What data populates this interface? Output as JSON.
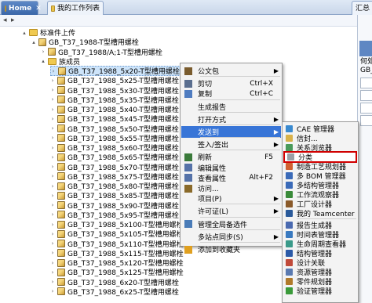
{
  "tabs": {
    "home": "Home",
    "worklist": "我的工作列表",
    "summary": "汇总"
  },
  "right_panel": {
    "line1": "何处引",
    "line2": "GB_T"
  },
  "tree": [
    {
      "text": "标准件上传",
      "indent": 1,
      "icon": "folder",
      "twist": "▴"
    },
    {
      "text": "GB_T37_1988-T型槽用螺栓",
      "indent": 2,
      "icon": "item",
      "twist": "▴"
    },
    {
      "text": "GB_T37_1988/A;1-T型槽用螺栓",
      "indent": 3,
      "icon": "item",
      "twist": "›"
    },
    {
      "text": "族成员",
      "indent": 3,
      "icon": "folder",
      "twist": "▴"
    },
    {
      "text": "GB_T37_1988_5x20-T型槽用螺栓",
      "indent": 4,
      "icon": "item",
      "twist": "›",
      "selected": true
    },
    {
      "text": "GB_T37_1988_5x25-T型槽用螺栓",
      "indent": 4,
      "icon": "item",
      "twist": "›"
    },
    {
      "text": "GB_T37_1988_5x30-T型槽用螺栓",
      "indent": 4,
      "icon": "item",
      "twist": "›"
    },
    {
      "text": "GB_T37_1988_5x35-T型槽用螺栓",
      "indent": 4,
      "icon": "item",
      "twist": "›"
    },
    {
      "text": "GB_T37_1988_5x40-T型槽用螺栓",
      "indent": 4,
      "icon": "item",
      "twist": "›"
    },
    {
      "text": "GB_T37_1988_5x45-T型槽用螺栓",
      "indent": 4,
      "icon": "item",
      "twist": "›"
    },
    {
      "text": "GB_T37_1988_5x50-T型槽用螺栓",
      "indent": 4,
      "icon": "item",
      "twist": "›"
    },
    {
      "text": "GB_T37_1988_5x55-T型槽用螺栓",
      "indent": 4,
      "icon": "item",
      "twist": "›"
    },
    {
      "text": "GB_T37_1988_5x60-T型槽用螺栓",
      "indent": 4,
      "icon": "item",
      "twist": "›"
    },
    {
      "text": "GB_T37_1988_5x65-T型槽用螺栓",
      "indent": 4,
      "icon": "item",
      "twist": "›"
    },
    {
      "text": "GB_T37_1988_5x70-T型槽用螺栓",
      "indent": 4,
      "icon": "item",
      "twist": "›"
    },
    {
      "text": "GB_T37_1988_5x75-T型槽用螺栓",
      "indent": 4,
      "icon": "item",
      "twist": "›"
    },
    {
      "text": "GB_T37_1988_5x80-T型槽用螺栓",
      "indent": 4,
      "icon": "item",
      "twist": "›"
    },
    {
      "text": "GB_T37_1988_5x85-T型槽用螺栓",
      "indent": 4,
      "icon": "item",
      "twist": "›"
    },
    {
      "text": "GB_T37_1988_5x90-T型槽用螺栓",
      "indent": 4,
      "icon": "item",
      "twist": "›"
    },
    {
      "text": "GB_T37_1988_5x95-T型槽用螺栓",
      "indent": 4,
      "icon": "item",
      "twist": "›"
    },
    {
      "text": "GB_T37_1988_5x100-T型槽用螺栓",
      "indent": 4,
      "icon": "item",
      "twist": "›"
    },
    {
      "text": "GB_T37_1988_5x105-T型槽用螺栓",
      "indent": 4,
      "icon": "item",
      "twist": "›"
    },
    {
      "text": "GB_T37_1988_5x110-T型槽用螺栓",
      "indent": 4,
      "icon": "item",
      "twist": "›"
    },
    {
      "text": "GB_T37_1988_5x115-T型槽用螺栓",
      "indent": 4,
      "icon": "item",
      "twist": "›"
    },
    {
      "text": "GB_T37_1988_5x120-T型槽用螺栓",
      "indent": 4,
      "icon": "item",
      "twist": "›"
    },
    {
      "text": "GB_T37_1988_5x125-T型槽用螺栓",
      "indent": 4,
      "icon": "item",
      "twist": "›"
    },
    {
      "text": "GB_T37_1988_6x20-T型槽用螺栓",
      "indent": 4,
      "icon": "item",
      "twist": "›"
    },
    {
      "text": "GB_T37_1988_6x25-T型槽用螺栓",
      "indent": 4,
      "icon": "item",
      "twist": "›"
    }
  ],
  "context_menu": [
    {
      "label": "公文包",
      "submenu": true,
      "icon": "briefcase-icon",
      "color": "#7a5c2e"
    },
    {
      "sep": true
    },
    {
      "label": "剪切",
      "shortcut": "Ctrl+X",
      "icon": "cut-icon",
      "color": "#5b6f8f"
    },
    {
      "label": "复制",
      "shortcut": "Ctrl+C",
      "icon": "copy-icon",
      "color": "#4f7cc0"
    },
    {
      "sep": true
    },
    {
      "label": "生成报告",
      "icon": "report-icon",
      "color": "#ffffff"
    },
    {
      "sep": true
    },
    {
      "label": "打开方式",
      "submenu": true,
      "icon": "open-with-icon",
      "color": "#ffffff"
    },
    {
      "sep": true
    },
    {
      "label": "发送到",
      "submenu": true,
      "icon": "send-to-icon",
      "color": "#ffffff",
      "highlighted": true
    },
    {
      "sep": true
    },
    {
      "label": "签入/签出",
      "submenu": true,
      "icon": "checkin-icon",
      "color": "#ffffff"
    },
    {
      "sep": true
    },
    {
      "label": "刷新",
      "shortcut": "F5",
      "icon": "refresh-icon",
      "color": "#3a7a3a"
    },
    {
      "label": "编辑属性",
      "icon": "edit-properties-icon",
      "color": "#5572a8"
    },
    {
      "label": "查看属性",
      "shortcut": "Alt+F2",
      "icon": "view-properties-icon",
      "color": "#5572a8"
    },
    {
      "label": "访问...",
      "icon": "access-icon",
      "color": "#8a6a2a"
    },
    {
      "label": "项目(P)",
      "submenu": true,
      "icon": "project-icon",
      "color": "#ffffff"
    },
    {
      "sep": true
    },
    {
      "label": "许可证(L)",
      "submenu": true,
      "icon": "license-icon",
      "color": "#ffffff"
    },
    {
      "sep": true
    },
    {
      "label": "管理全局备选件",
      "icon": "global-alternates-icon",
      "color": "#4a7cb8"
    },
    {
      "sep": true
    },
    {
      "label": "多站点同步(S)",
      "submenu": true,
      "icon": "multisite-icon",
      "color": "#ffffff"
    },
    {
      "sep": true
    },
    {
      "label": "添加到收藏夹",
      "icon": "favorites-icon",
      "color": "#e0a020"
    }
  ],
  "send_to_menu": [
    {
      "label": "CAE 管理器",
      "icon": "cae-manager-icon",
      "color": "#3a8ad0"
    },
    {
      "label": "信封...",
      "icon": "envelope-icon",
      "color": "#d9b24a"
    },
    {
      "label": "关系浏览器",
      "icon": "relation-browser-icon",
      "color": "#4a9a5a"
    },
    {
      "label": "分类",
      "icon": "classification-icon",
      "color": "#9aa0a6",
      "boxed": true
    },
    {
      "label": "制造工艺规划器",
      "icon": "process-planner-icon",
      "color": "#d06030"
    },
    {
      "label": "多 BOM 管理器",
      "icon": "multi-bom-icon",
      "color": "#3a6ab8"
    },
    {
      "label": "多结构管理器",
      "icon": "multi-structure-icon",
      "color": "#3a6ab8"
    },
    {
      "label": "工作流观察器",
      "icon": "workflow-viewer-icon",
      "color": "#3a8a3a"
    },
    {
      "label": "工厂设计器",
      "icon": "plant-designer-icon",
      "color": "#8a5a2a"
    },
    {
      "label": "我的 Teamcenter",
      "icon": "my-teamcenter-icon",
      "color": "#2a5a9a"
    },
    {
      "sep": true
    },
    {
      "label": "报告生成器",
      "icon": "report-builder-icon",
      "color": "#4a6ab0"
    },
    {
      "label": "时间表管理器",
      "icon": "schedule-manager-icon",
      "color": "#3a7ac0"
    },
    {
      "label": "生命周期查看器",
      "icon": "lifecycle-viewer-icon",
      "color": "#3a9a8a"
    },
    {
      "label": "结构管理器",
      "icon": "structure-manager-icon",
      "color": "#2a5aa8"
    },
    {
      "label": "设计关联",
      "icon": "design-context-icon",
      "color": "#c04a3a"
    },
    {
      "label": "资源管理器",
      "icon": "resource-manager-icon",
      "color": "#5a7ab0"
    },
    {
      "label": "零件规划器",
      "icon": "part-planner-icon",
      "color": "#b07a2a"
    },
    {
      "label": "验证管理器",
      "icon": "validation-manager-icon",
      "color": "#3a9a3a"
    }
  ]
}
